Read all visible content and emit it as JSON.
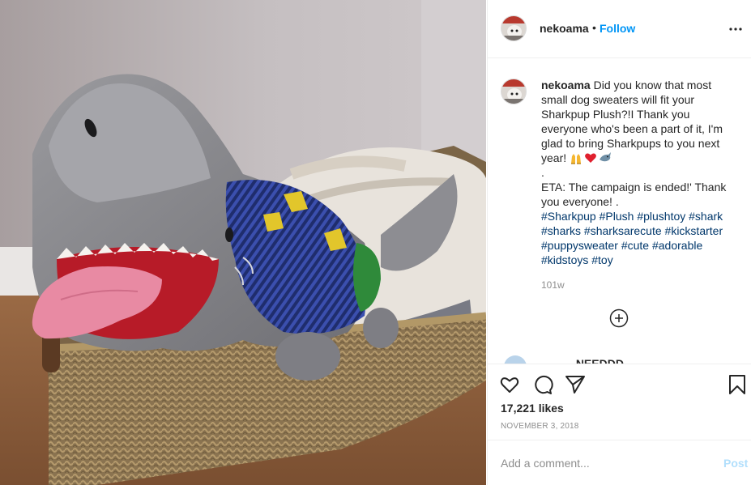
{
  "post": {
    "image_alt": "Sharkpup plush wearing a dog sweater in a wicker basket"
  },
  "header": {
    "username": "nekoama",
    "separator": "•",
    "follow_label": "Follow",
    "more_icon": "more-options-icon"
  },
  "caption": {
    "username": "nekoama",
    "text_1": "Did you know that most small dog sweaters will fit your Sharkpup Plush?!I Thank you everyone who's been a part of it, I'm glad to bring Sharkpups to you next year!",
    "emoji": [
      "raising-hands-emoji",
      "red-heart-emoji",
      "shark-emoji"
    ],
    "dot_line": ".",
    "text_2": "ETA: The campaign is ended!' Thank you everyone! .",
    "hashtags": [
      "#Sharkpup",
      "#Plush",
      "#plushtoy",
      "#shark",
      "#sharks",
      "#sharksarecute",
      "#kickstarter",
      "#puppysweater",
      "#cute",
      "#adorable",
      "#kidstoys",
      "#toy"
    ],
    "time_ago": "101w"
  },
  "load_more_icon": "plus-circle-icon",
  "partial_comment": "_____ NEEDDD",
  "actions": {
    "icons": [
      "heart-icon",
      "comment-icon",
      "share-icon",
      "bookmark-icon"
    ]
  },
  "likes": "17,221 likes",
  "date": "NOVEMBER 3, 2018",
  "add_comment": {
    "placeholder": "Add a comment...",
    "post_label": "Post"
  },
  "colors": {
    "link": "#0095f6",
    "hashtag": "#00376b",
    "muted": "#8e8e8e",
    "post_disabled": "#b2dffc"
  }
}
